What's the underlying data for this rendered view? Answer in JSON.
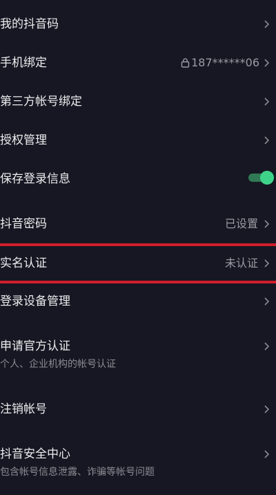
{
  "rows": [
    {
      "label": "我的抖音码"
    },
    {
      "label": "手机绑定",
      "value": "187******06",
      "value_icon": "lock-icon"
    },
    {
      "label": "第三方帐号绑定"
    },
    {
      "label": "授权管理"
    },
    {
      "label": "保存登录信息",
      "toggle_on": true
    },
    {
      "label": "抖音密码",
      "value": "已设置"
    },
    {
      "label": "实名认证",
      "value": "未认证"
    },
    {
      "label": "登录设备管理"
    },
    {
      "label": "申请官方认证",
      "subtitle": "个人、企业机构的帐号认证"
    },
    {
      "label": "注销帐号"
    },
    {
      "label": "抖音安全中心",
      "subtitle": "包含帐号信息泄露、诈骗等帐号问题"
    }
  ],
  "colors": {
    "background": "#161722",
    "highlight_border": "#d21e2c",
    "toggle_accent": "#3fd38a"
  }
}
